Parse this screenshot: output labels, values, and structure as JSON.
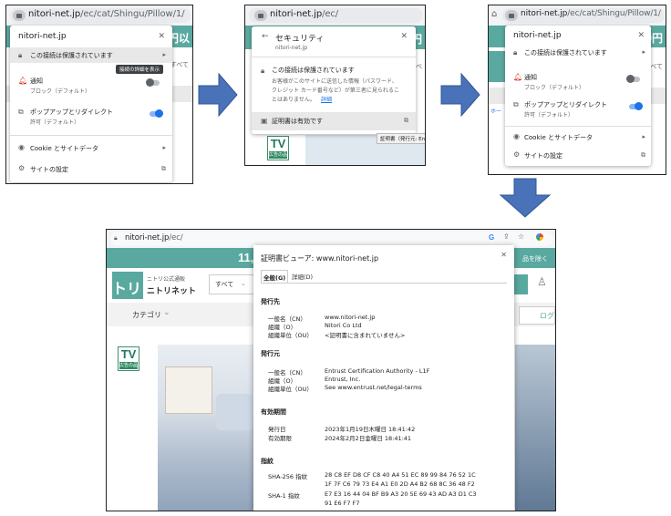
{
  "shot1": {
    "url_host": "nitori-net.jp",
    "url_path": "/ec/cat/Shingu/Pillow/1/",
    "site_name": "nitori-net.jp",
    "close": "✕",
    "connection_secure": "この接続は保護されています",
    "tooltip": "接続の詳細を表示",
    "notifications": "通知",
    "notifications_sub": "ブロック（デフォルト）",
    "popups": "ポップアップとリダイレクト",
    "popups_sub": "許可（デフォルト）",
    "cookies": "Cookie とサイトデータ",
    "site_settings": "サイトの設定",
    "bg_price": "00円以",
    "bg_text": "すべて"
  },
  "shot2": {
    "url_host": "nitori-net.jp",
    "url_path": "/ec/",
    "back": "←",
    "title": "セキュリティ",
    "subtitle": "nitori-net.jp",
    "close": "✕",
    "secure_title": "この接続は保護されています",
    "secure_desc_1": "お客様がこのサイトに送信した情報（パスワード、",
    "secure_desc_2": "クレジット カード番号など）が第三者に見られるこ",
    "secure_desc_3": "とはありません。",
    "details_link": "詳細",
    "cert_valid": "証明書は有効です",
    "tooltip": "証明書（発行元: Entrust",
    "bg_price": "00円",
    "bg_text": "すべ",
    "tv": "TV",
    "tv_sub": "広告の品"
  },
  "shot3": {
    "url_host": "nitori-net.jp",
    "url_path": "/ec/cat/Shingu/Pillow/1/",
    "site_name": "nitori-net.jp",
    "close": "✕",
    "connection_secure": "この接続は保護されています",
    "notifications": "通知",
    "notifications_sub": "ブロック（デフォルト）",
    "popups": "ポップアップとリダイレクト",
    "popups_sub": "許可（デフォルト）",
    "cookies": "Cookie とサイトデータ",
    "site_settings": "サイトの設定",
    "bg_price": "00円",
    "bg_text": "すべて",
    "bg_left": "ホー"
  },
  "shot4": {
    "url_host": "nitori-net.jp",
    "url_path": "/ec/",
    "banner_num": "11,",
    "banner_right": "品を除く",
    "brand_sub": "ニトリ公式通販",
    "brand_name": "ニトリネット",
    "logo": "トリ",
    "search_scope": "すべて",
    "category": "カテゴリ",
    "login": "ログ",
    "tv": "TV",
    "tv_sub": "広告の品",
    "viewer": {
      "title": "証明書ビューア: www.nitori-net.jp",
      "close": "✕",
      "tab_general": "全般(G)",
      "tab_details": "詳細(D)",
      "issued_to_title": "発行先",
      "issued_by_title": "発行元",
      "validity_title": "有効期間",
      "fingerprint_title": "指紋",
      "labels": {
        "cn": "一般名（CN）",
        "o": "組織（O）",
        "ou": "組織単位（OU）",
        "issued_on": "発行日",
        "expires_on": "有効期限",
        "sha256": "SHA-256 指紋",
        "sha1": "SHA-1 指紋"
      },
      "issued_to": {
        "cn": "www.nitori-net.jp",
        "o": "Nitori Co Ltd",
        "ou": "<証明書に含まれていません>"
      },
      "issued_by": {
        "cn": "Entrust Certification Authority - L1F",
        "o": "Entrust, Inc.",
        "ou": "See www.entrust.net/legal-terms"
      },
      "validity": {
        "issued_on": "2023年1月19日木曜日 18:41:42",
        "expires_on": "2024年2月2日金曜日 18:41:41"
      },
      "fingerprints": {
        "sha256_1": "28 C8 EF D8 CF C8 40 A4 51 EC 89 99 84 76 52 1C",
        "sha256_2": "1F 7F C6 79 73 E4 A1 E0 2D A4 B2 68 8C 36 48 F2",
        "sha1_1": "E7 E3 16 44 04 BF B9 A3 20 5E 69 43 AD A3 D1 C3",
        "sha1_2": "91 E6 F7 F7"
      }
    }
  },
  "colors": {
    "arrow": "#4a72b8",
    "teal": "#5aa9a0",
    "toggle_on": "#1a73e8"
  }
}
